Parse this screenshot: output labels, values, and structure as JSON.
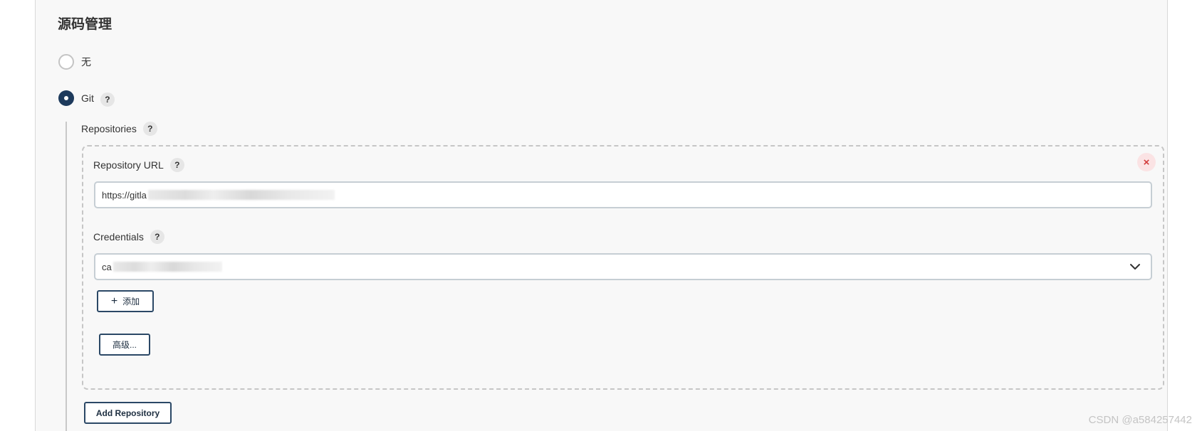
{
  "section": {
    "title": "源码管理"
  },
  "scm_options": [
    {
      "label": "无",
      "checked": false
    },
    {
      "label": "Git",
      "checked": true
    }
  ],
  "help_glyph": "?",
  "repositories": {
    "label": "Repositories",
    "repository_url": {
      "label": "Repository URL",
      "value": "https://gitla"
    },
    "credentials": {
      "label": "Credentials",
      "value": "ca"
    },
    "add_button": {
      "icon": "plus-icon",
      "label": "添加"
    },
    "advanced_button": {
      "label": "高级..."
    },
    "remove_glyph": "×"
  },
  "add_repository_button": {
    "label": "Add Repository"
  },
  "watermark": "CSDN @a584257442",
  "colors": {
    "accent": "#1d3a5c",
    "remove_bg": "#fbe3e4",
    "remove_fg": "#d23a3a",
    "panel_bg": "#f8f8f8"
  }
}
